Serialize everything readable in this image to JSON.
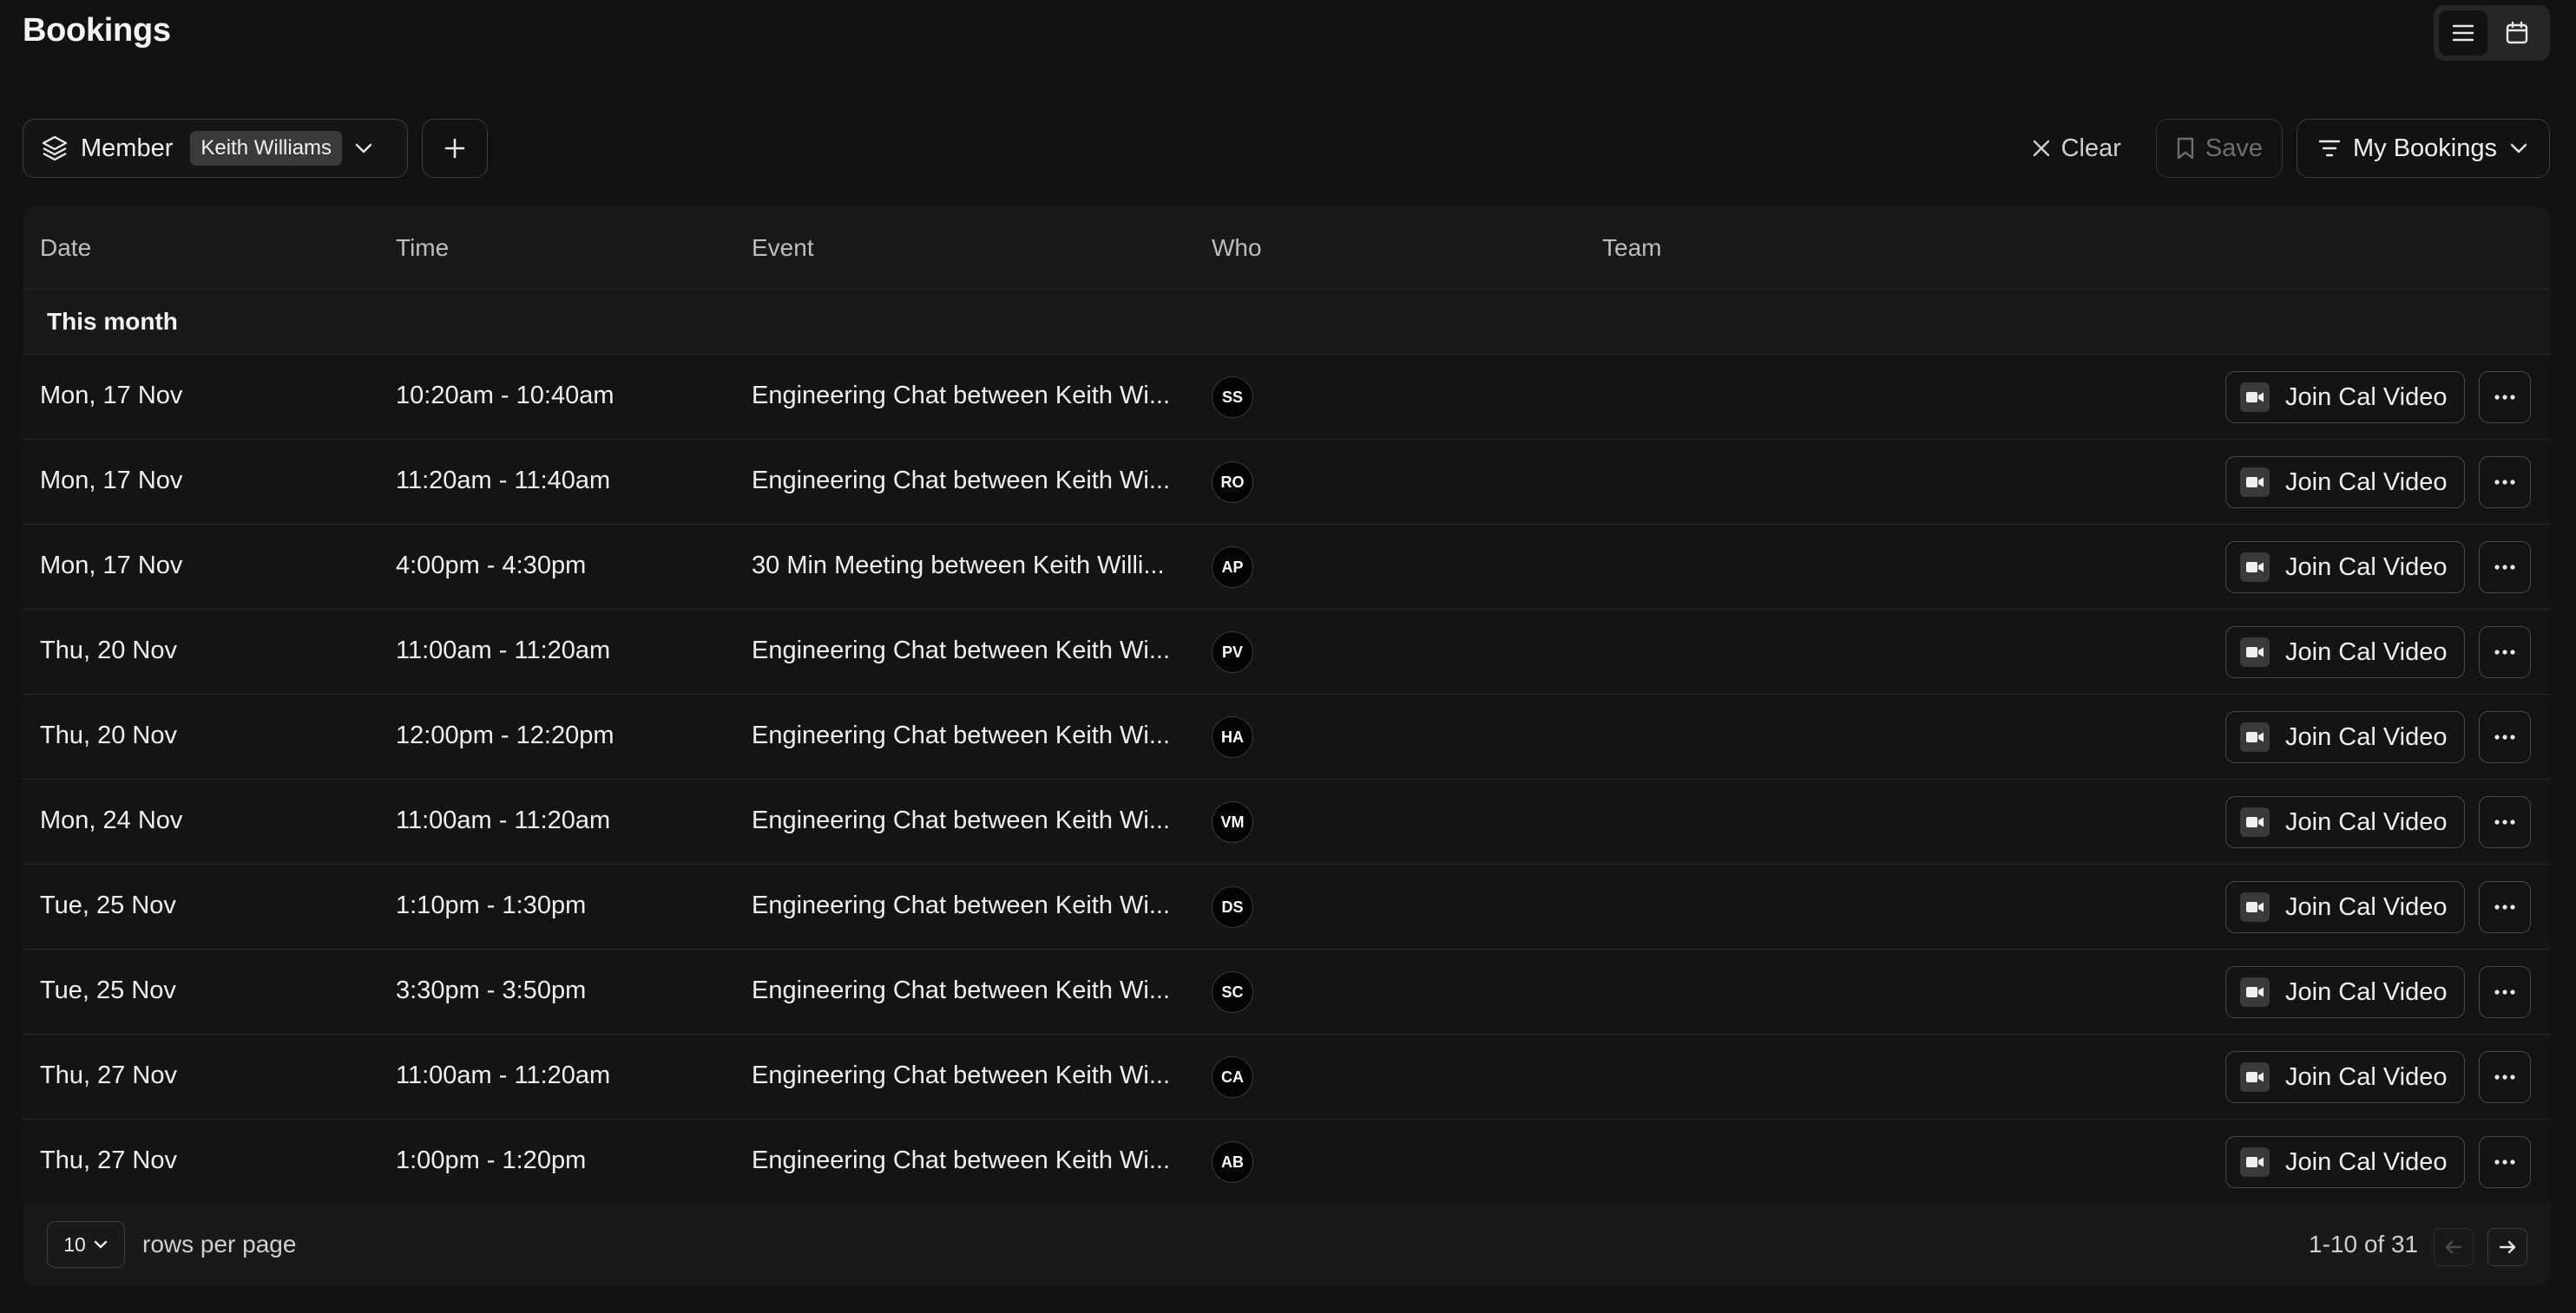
{
  "header": {
    "title": "Bookings"
  },
  "view_toggle": {
    "list_icon": "list-icon",
    "calendar_icon": "calendar-icon",
    "active": "list"
  },
  "filters": {
    "member_label": "Member",
    "member_value": "Keith Williams",
    "clear_label": "Clear",
    "save_label": "Save",
    "view_label": "My Bookings"
  },
  "table": {
    "columns": [
      "Date",
      "Time",
      "Event",
      "Who",
      "Team"
    ],
    "section": "This month",
    "join_label": "Join Cal Video",
    "rows": [
      {
        "date": "Mon, 17 Nov",
        "time": "10:20am - 10:40am",
        "event": "Engineering Chat between Keith Wi...",
        "who": "SS"
      },
      {
        "date": "Mon, 17 Nov",
        "time": "11:20am - 11:40am",
        "event": "Engineering Chat between Keith Wi...",
        "who": "RO"
      },
      {
        "date": "Mon, 17 Nov",
        "time": "4:00pm - 4:30pm",
        "event": "30 Min Meeting between Keith Willi...",
        "who": "AP"
      },
      {
        "date": "Thu, 20 Nov",
        "time": "11:00am - 11:20am",
        "event": "Engineering Chat between Keith Wi...",
        "who": "PV"
      },
      {
        "date": "Thu, 20 Nov",
        "time": "12:00pm - 12:20pm",
        "event": "Engineering Chat between Keith Wi...",
        "who": "HA"
      },
      {
        "date": "Mon, 24 Nov",
        "time": "11:00am - 11:20am",
        "event": "Engineering Chat between Keith Wi...",
        "who": "VM"
      },
      {
        "date": "Tue, 25 Nov",
        "time": "1:10pm - 1:30pm",
        "event": "Engineering Chat between Keith Wi...",
        "who": "DS"
      },
      {
        "date": "Tue, 25 Nov",
        "time": "3:30pm - 3:50pm",
        "event": "Engineering Chat between Keith Wi...",
        "who": "SC"
      },
      {
        "date": "Thu, 27 Nov",
        "time": "11:00am - 11:20am",
        "event": "Engineering Chat between Keith Wi...",
        "who": "CA"
      },
      {
        "date": "Thu, 27 Nov",
        "time": "1:00pm - 1:20pm",
        "event": "Engineering Chat between Keith Wi...",
        "who": "AB"
      }
    ]
  },
  "pagination": {
    "page_size": "10",
    "rows_per_page_label": "rows per page",
    "range": "1-10 of 31"
  },
  "colors": {
    "background": "#121212",
    "card": "#191919",
    "row": "#141414",
    "border": "#2a2a2a"
  }
}
